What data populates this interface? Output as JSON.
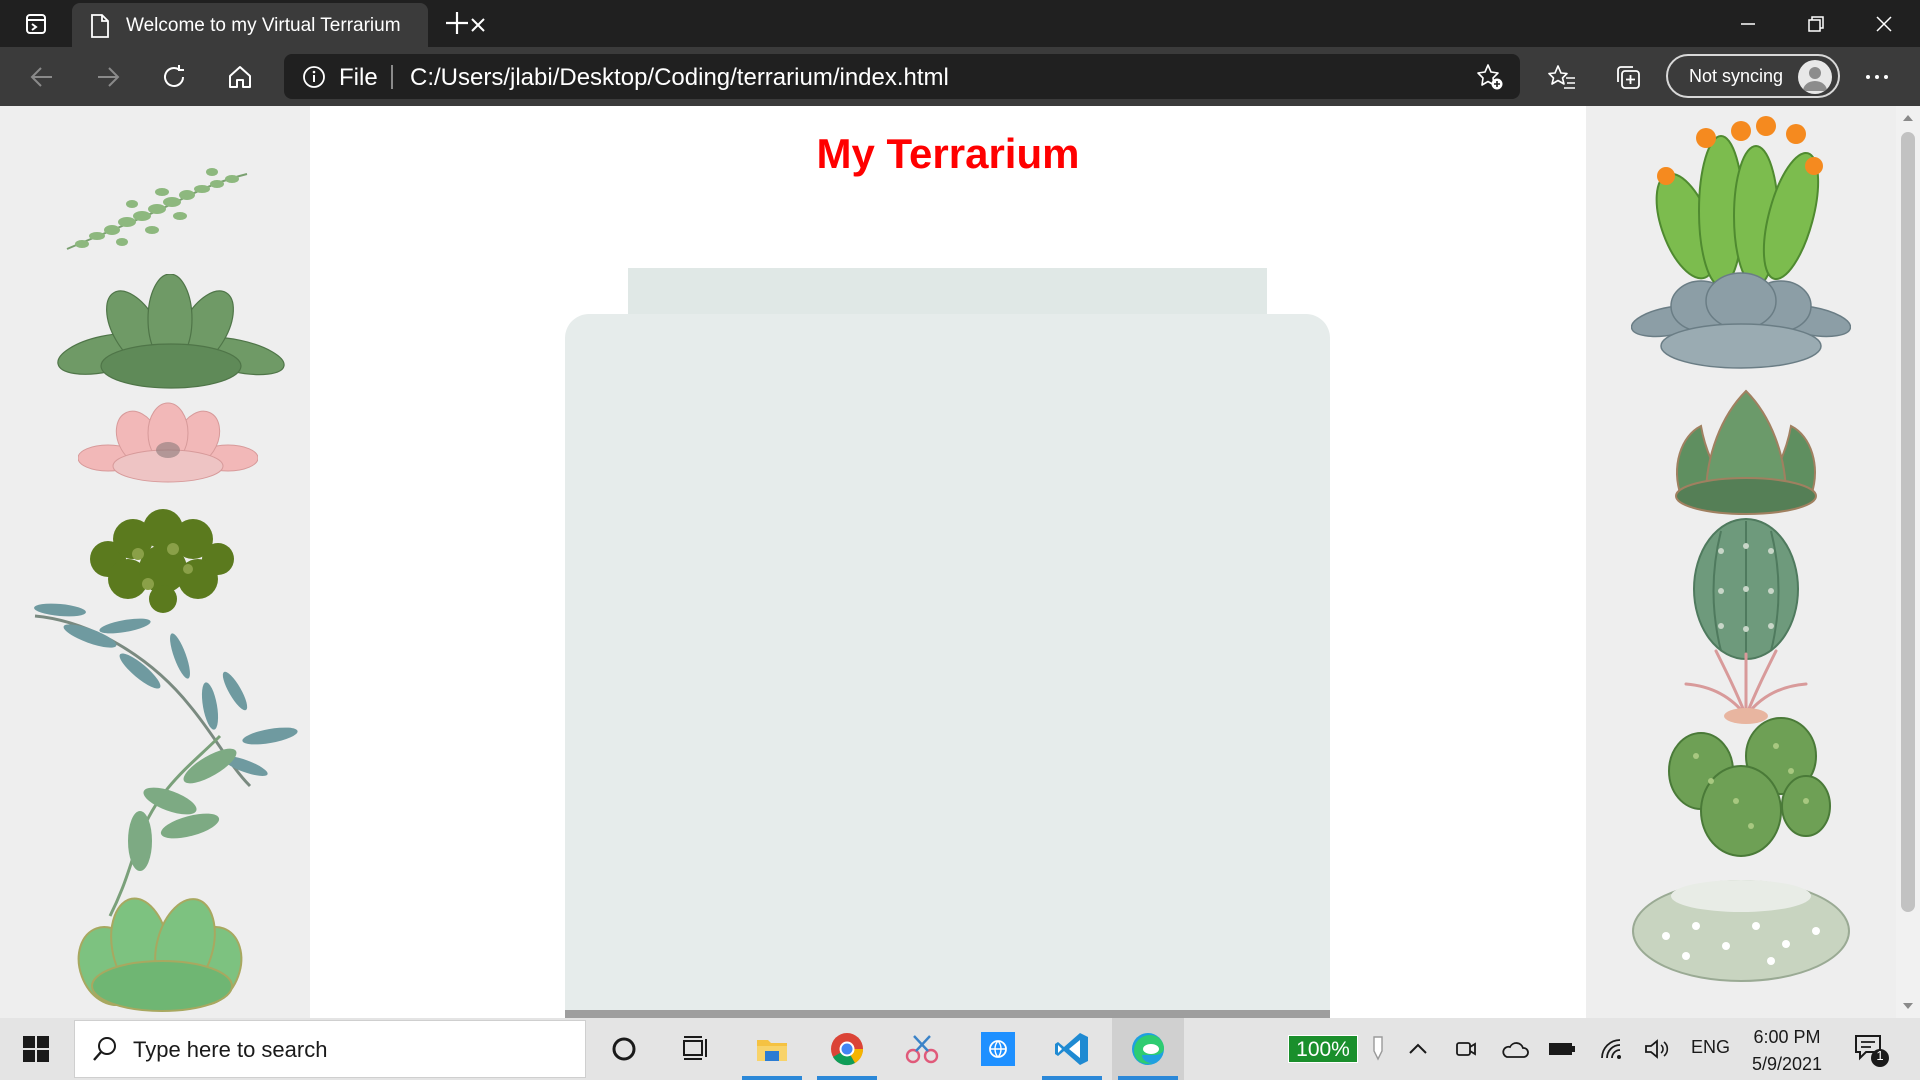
{
  "browser": {
    "tab_title": "Welcome to my Virtual Terrarium",
    "omnibox": {
      "scheme": "File",
      "url": "C:/Users/jlabi/Desktop/Coding/terrarium/index.html"
    },
    "sync_label": "Not syncing",
    "icons": [
      "tab-actions-icon",
      "document-icon",
      "close-icon",
      "new-tab-icon",
      "minimize-icon",
      "restore-icon",
      "window-close-icon",
      "back-icon",
      "forward-icon",
      "refresh-icon",
      "home-icon",
      "info-icon",
      "add-favorite-icon",
      "favorites-icon",
      "collections-icon",
      "avatar-icon",
      "more-icon"
    ]
  },
  "page": {
    "title": "My Terrarium",
    "colors": {
      "title": "#ff0000",
      "side_panel": "#eeeeee",
      "jar": "#e6eceb",
      "jar_top": "#e0e8e6",
      "jar_bottom": "#9e9e9e"
    },
    "left_plants": [
      "fern-plant",
      "echeveria-green-plant",
      "pink-succulent-plant",
      "moss-plant",
      "eucalyptus-plant",
      "aloe-rosette-plant"
    ],
    "right_plants": [
      "flowering-cactus-plant",
      "silver-succulent-plant",
      "agave-plant",
      "barrel-cactus-plant",
      "air-plant",
      "prickly-pear-plant",
      "snowball-cactus-plant"
    ]
  },
  "taskbar": {
    "search_placeholder": "Type here to search",
    "battery_badge": "100%",
    "language": "ENG",
    "time": "6:00 PM",
    "date": "5/9/2021",
    "notification_count": "1",
    "apps": [
      "cortana-icon",
      "task-view-icon",
      "file-explorer-icon",
      "chrome-icon",
      "snip-sketch-icon",
      "web-app-icon",
      "vscode-icon",
      "edge-icon"
    ]
  }
}
